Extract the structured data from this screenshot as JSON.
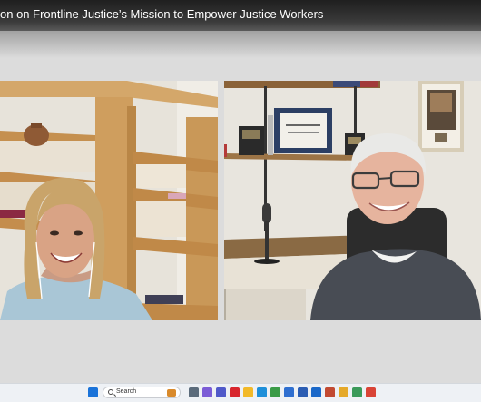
{
  "video": {
    "title": "on on Frontline Justice’s Mission to Empower Justice Workers"
  },
  "taskbar": {
    "search_placeholder": "Search",
    "icons": [
      {
        "name": "windows-start-icon",
        "color": "#1a73d9"
      },
      {
        "name": "task-view-icon",
        "color": "#5b6b7b"
      },
      {
        "name": "copilot-icon",
        "color": "#7b5cd6"
      },
      {
        "name": "teams-icon",
        "color": "#5059c9"
      },
      {
        "name": "acrobat-icon",
        "color": "#d8262e"
      },
      {
        "name": "file-explorer-icon",
        "color": "#f2b929"
      },
      {
        "name": "edge-icon",
        "color": "#1e8fd9"
      },
      {
        "name": "chrome-icon",
        "color": "#3a9b47"
      },
      {
        "name": "calendar-icon",
        "color": "#2f6fd0"
      },
      {
        "name": "word-icon",
        "color": "#2b5db3"
      },
      {
        "name": "outlook-icon",
        "color": "#1a68c9"
      },
      {
        "name": "photos-icon",
        "color": "#c24a32"
      },
      {
        "name": "chrome-profile-icon",
        "color": "#e5a92a"
      },
      {
        "name": "maps-icon",
        "color": "#3b9a5a"
      },
      {
        "name": "chrome-alt-icon",
        "color": "#d94436"
      }
    ]
  }
}
